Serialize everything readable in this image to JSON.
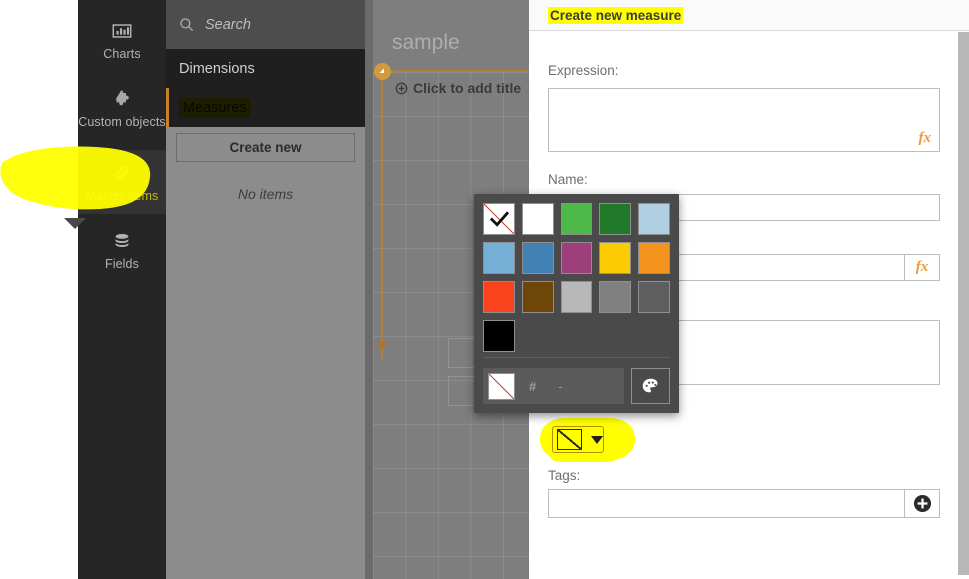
{
  "rail": {
    "items": [
      {
        "label": "Charts",
        "icon": "bar-chart-icon",
        "active": false
      },
      {
        "label": "Custom objects",
        "icon": "puzzle-piece-icon",
        "active": false
      },
      {
        "label": "Master items",
        "icon": "link-chain-icon",
        "active": true
      },
      {
        "label": "Fields",
        "icon": "database-stack-icon",
        "active": false
      }
    ]
  },
  "master_items": {
    "search": {
      "placeholder": "Search",
      "value": "",
      "icon": "search-icon"
    },
    "tabs": [
      {
        "label": "Dimensions",
        "selected": false
      },
      {
        "label": "Measures",
        "selected": true
      }
    ],
    "create_new_label": "Create new",
    "empty_text": "No items"
  },
  "sheet": {
    "title": "sample",
    "add_title_text": "Click to add title",
    "add_title_icon": "add-object-icon",
    "handle_icon": "resize-handle-icon"
  },
  "form": {
    "header_title": "Create new measure",
    "expression": {
      "label": "Expression:",
      "value": "",
      "fx_label": "fx"
    },
    "name": {
      "label": "Name:",
      "value": ""
    },
    "description": {
      "value": "",
      "fx_label": "fx"
    },
    "comment": {
      "value": ""
    },
    "color": {
      "swatch_icon": "no-color-icon",
      "caret_icon": "chevron-down-icon"
    },
    "tags": {
      "label": "Tags:",
      "value": "",
      "add_icon": "plus-circle-icon"
    }
  },
  "color_picker": {
    "selected_index": 0,
    "swatches": [
      {
        "name": "none",
        "hex": "#ffffff",
        "is_none": true
      },
      {
        "name": "white",
        "hex": "#ffffff",
        "is_none": false
      },
      {
        "name": "green",
        "hex": "#4cb949",
        "is_none": false
      },
      {
        "name": "dark-green",
        "hex": "#21792a",
        "is_none": false
      },
      {
        "name": "light-blue",
        "hex": "#b0cfe3",
        "is_none": false
      },
      {
        "name": "sky-blue",
        "hex": "#77b0d6",
        "is_none": false
      },
      {
        "name": "blue",
        "hex": "#4281b4",
        "is_none": false
      },
      {
        "name": "magenta",
        "hex": "#9c3f7b",
        "is_none": false
      },
      {
        "name": "yellow",
        "hex": "#fdcb04",
        "is_none": false
      },
      {
        "name": "orange",
        "hex": "#f4931e",
        "is_none": false
      },
      {
        "name": "red",
        "hex": "#f9431c",
        "is_none": false
      },
      {
        "name": "brown",
        "hex": "#6e4708",
        "is_none": false
      },
      {
        "name": "light-gray",
        "hex": "#b8b8b8",
        "is_none": false
      },
      {
        "name": "gray",
        "hex": "#808080",
        "is_none": false
      },
      {
        "name": "dark-gray",
        "hex": "#5e5e5e",
        "is_none": false
      },
      {
        "name": "black",
        "hex": "#000000",
        "is_none": false
      }
    ],
    "hex_prefix": "#",
    "hex_value": "-",
    "custom_button_icon": "palette-icon"
  },
  "colors": {
    "accent": "#c8822a",
    "highlight": "#ffff00",
    "rail_bg": "#262626",
    "panel_bg": "#8c8c8c",
    "popup_bg": "#4a4a4a",
    "fx_orange": "#ef9a33"
  }
}
